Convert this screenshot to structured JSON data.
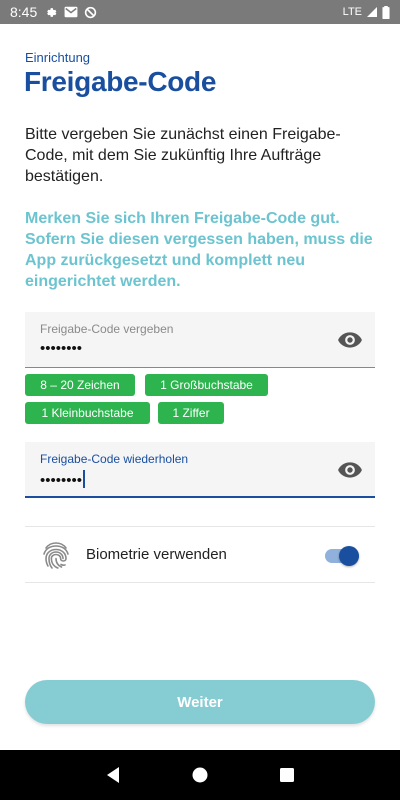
{
  "status_bar": {
    "time": "8:45",
    "network": "LTE",
    "icons": [
      "gear-icon",
      "gmail-icon",
      "do-not-disturb-icon",
      "signal-icon",
      "battery-icon"
    ]
  },
  "header": {
    "eyebrow": "Einrichtung",
    "title": "Freigabe-Code"
  },
  "intro_text": "Bitte vergeben Sie zunächst einen Freigabe-Code, mit dem Sie zukünftig Ihre Aufträge bestätigen.",
  "note_text": "Merken Sie sich Ihren Freigabe-Code gut. Sofern Sie diesen vergessen haben, muss die App zurückgesetzt und komplett neu eingerichtet werden.",
  "code_field": {
    "label": "Freigabe-Code vergeben",
    "value": "••••••••"
  },
  "rules": [
    {
      "label": "8 – 20 Zeichen"
    },
    {
      "label": "1 Großbuchstabe"
    },
    {
      "label": "1 Kleinbuchstabe"
    },
    {
      "label": "1 Ziffer"
    }
  ],
  "repeat_field": {
    "label": "Freigabe-Code wiederholen",
    "value": "••••••••"
  },
  "biometrics": {
    "label": "Biometrie verwenden",
    "enabled": true
  },
  "primary_button": {
    "label": "Weiter"
  },
  "colors": {
    "brand": "#1a4fa0",
    "note": "#6bc4cf",
    "chip": "#2db44f",
    "button": "#86cdd3"
  }
}
